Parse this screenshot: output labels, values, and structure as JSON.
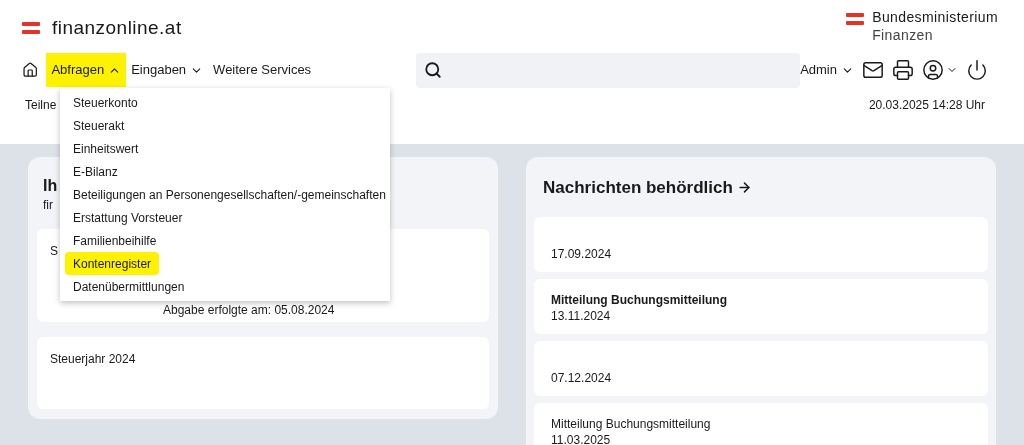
{
  "header": {
    "site_name": "finanzonline.at",
    "ministry": [
      "Bundesministerium",
      "Finanzen"
    ]
  },
  "nav": {
    "items": [
      {
        "label": "Abfragen",
        "has_menu": true,
        "expanded": true,
        "highlighted": true
      },
      {
        "label": "Eingaben",
        "has_menu": true,
        "expanded": false,
        "highlighted": false
      },
      {
        "label": "Weitere Services",
        "has_menu": false,
        "highlighted": false
      }
    ],
    "user": "Admin"
  },
  "menu": {
    "items": [
      {
        "label": "Steuerkonto",
        "highlighted": false
      },
      {
        "label": "Steuerakt",
        "highlighted": false
      },
      {
        "label": "Einheitswert",
        "highlighted": false
      },
      {
        "label": "E-Bilanz",
        "highlighted": false
      },
      {
        "label": "Beteiligungen an Personengesellschaften/-gemeinschaften",
        "highlighted": false
      },
      {
        "label": "Erstattung Vorsteuer",
        "highlighted": false
      },
      {
        "label": "Familienbeihilfe",
        "highlighted": false
      },
      {
        "label": "Kontenregister",
        "highlighted": true
      },
      {
        "label": "Datenübermittlungen",
        "highlighted": false
      }
    ]
  },
  "subbar": {
    "left": "Teilne",
    "datetime": "20.03.2025 14:28 Uhr"
  },
  "left_card": {
    "title": "Ih",
    "subtitle": "fir",
    "entries": [
      {
        "label": "S",
        "detail": "Abgabe erfolgte am: 05.08.2024"
      },
      {
        "label": "Steuerjahr 2024"
      }
    ]
  },
  "messages": {
    "title": "Nachrichten behördlich",
    "items": [
      {
        "date": "17.09.2024"
      },
      {
        "title": "Mitteilung Buchungsmitteilung",
        "unread": true,
        "date": "13.11.2024"
      },
      {
        "date": "07.12.2024"
      },
      {
        "title": "Mitteilung Buchungsmitteilung",
        "unread": false,
        "date": "11.03.2025"
      }
    ]
  }
}
